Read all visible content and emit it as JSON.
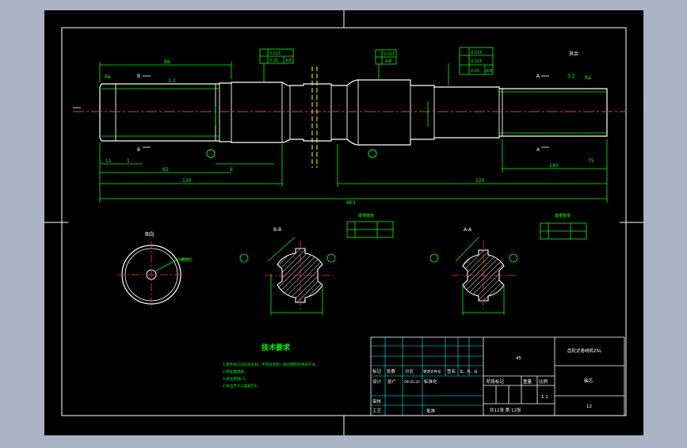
{
  "colors": {
    "window_bg": "#aab4c4",
    "paper": "#000000",
    "frame": "#ffffff",
    "part": "#ffffff",
    "dim": "#00ff00",
    "center": "#ff3333",
    "yellow": "#ffff00",
    "cyan": "#00ffff",
    "hatch": "#ffffff"
  },
  "dims": {
    "top_left": "88",
    "d_80": "80",
    "d_140": "140",
    "d_75": "75",
    "d_20": "20",
    "d_65": "65",
    "d_11": "11",
    "d_1": "1",
    "d_130": "130",
    "d_220": "220",
    "d_6": "6",
    "total": "863"
  },
  "views": {
    "section_a": "A-A",
    "section_b": "B-B",
    "end_view": "B向",
    "arrow_b": "B",
    "arrow_a": "A",
    "finish": "3.2",
    "rough": "Ra",
    "note_label": "其余",
    "leader1": "键槽宽度",
    "leader2": "键槽宽度",
    "side_label": "螺纹孔"
  },
  "tolerance": {
    "t1a": "0.015",
    "t1b": "0.05",
    "t1c": "A-B",
    "t2a": "0.015",
    "t2b": "A-B",
    "t3a": "0.015",
    "t3b": "0.015",
    "t3c": "0.05",
    "t3d": "A-B"
  },
  "notes": {
    "title": "技术要求",
    "items": [
      "1.零件加工前应去毛刺，不得有毛刺，锐边倒钝并清洗干净。",
      "2.热处理调质。",
      "3.未注倒角C1。",
      "4.未注尺寸公差按IT8。"
    ]
  },
  "titleblock": {
    "material": "45",
    "drawing_name": "齿轮式卷绕机ZSL",
    "part_name": "轴芯",
    "drawing_no": "12",
    "scale": "1:1",
    "sheet_label": "共12张  第  12张",
    "row_labels": [
      "标记",
      "处数",
      "分区",
      "更改文件号",
      "签名",
      "年、月、日"
    ],
    "designer": "设计",
    "designer_name": "张广",
    "date": "09.05.25",
    "standard": "标准化",
    "review": "审核",
    "process": "工艺",
    "approve": "批准",
    "stage_labels": [
      "阶段标记",
      "重量",
      "比例"
    ]
  }
}
